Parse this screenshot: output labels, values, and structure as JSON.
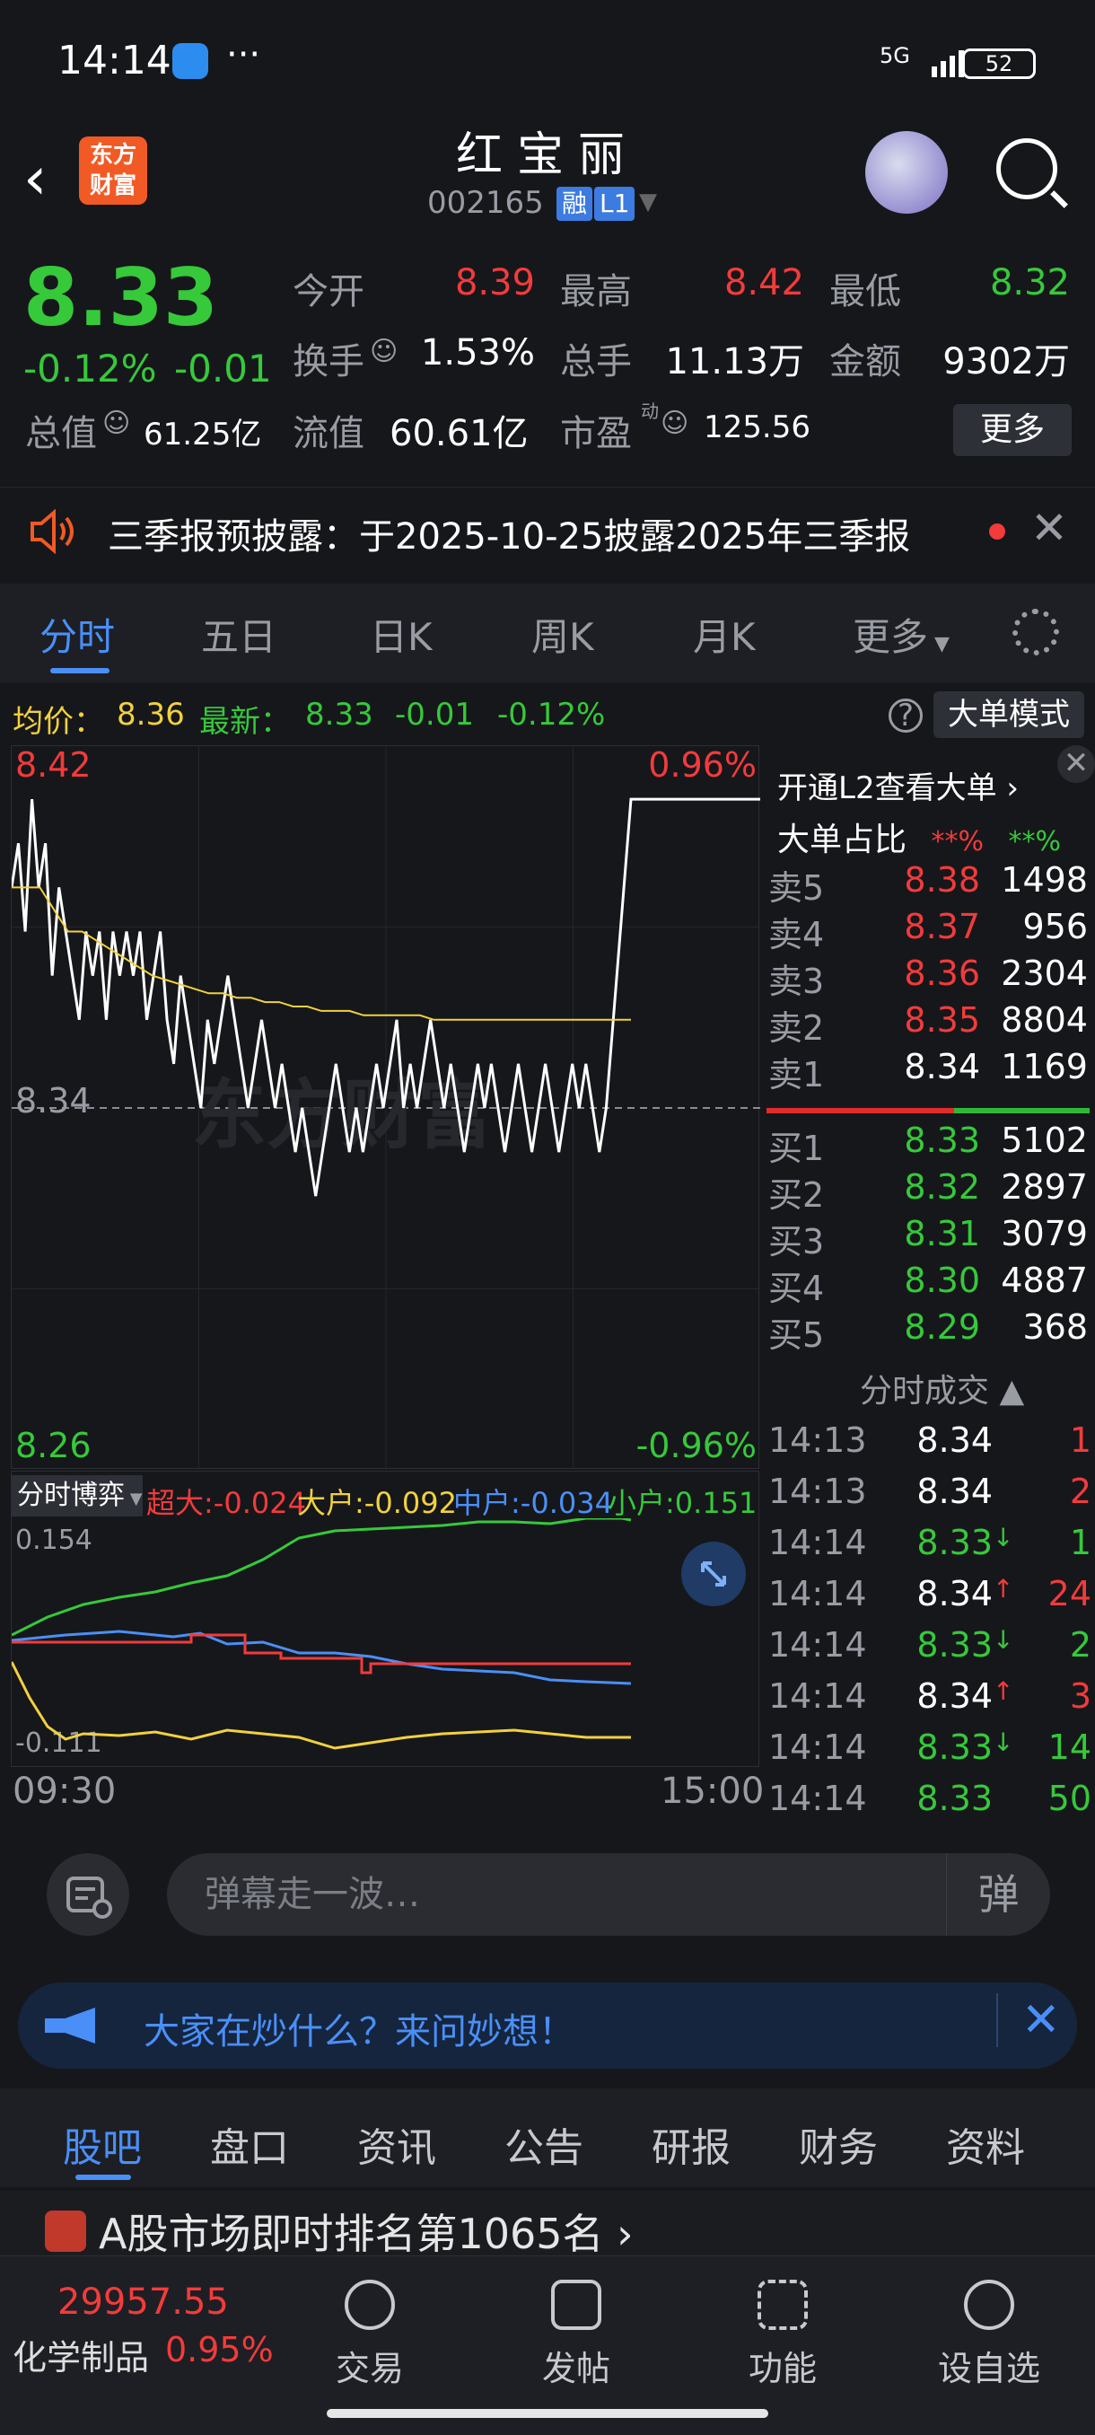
{
  "status_bar": {
    "time": "14:14",
    "more": "···",
    "network": "5G",
    "battery": "52"
  },
  "header": {
    "title": "红宝丽",
    "code": "002165",
    "tag_margin": "融",
    "tag_level": "L1",
    "logo_line1": "东方",
    "logo_line2": "财富"
  },
  "quote": {
    "price": "8.33",
    "change_pct": "-0.12%",
    "change_abs": "-0.01",
    "open_label": "今开",
    "open": "8.39",
    "high_label": "最高",
    "high": "8.42",
    "low_label": "最低",
    "low": "8.32",
    "turnover_label": "换手",
    "turnover": "1.53%",
    "volume_label": "总手",
    "volume": "11.13万",
    "amount_label": "金额",
    "amount": "9302万",
    "mktcap_label": "总值",
    "mktcap": "61.25亿",
    "float_label": "流值",
    "float_cap": "60.61亿",
    "pe_label": "市盈",
    "pe_sup": "动",
    "pe": "125.56",
    "more_label": "更多"
  },
  "notice": {
    "text": "三季报预披露：于2025-10-25披露2025年三季报"
  },
  "tabs": {
    "items": [
      "分时",
      "五日",
      "日K",
      "周K",
      "月K",
      "更多"
    ],
    "active": 0
  },
  "info_line": {
    "avg_label": "均价：",
    "avg": "8.36",
    "latest_label": "最新：",
    "latest": "8.33",
    "chg": "-0.01",
    "pct": "-0.12%",
    "big_order_mode": "大单模式",
    "help": "?"
  },
  "chart_data": {
    "type": "line",
    "y_top_label": "8.42",
    "y_mid_label": "8.34",
    "y_bottom_label": "8.26",
    "pct_top_label": "0.96%",
    "pct_bottom_label": "-0.96%",
    "watermark": "东方财富",
    "ylim": [
      8.26,
      8.42
    ],
    "prev_close": 8.34,
    "series": [
      {
        "name": "price",
        "color": "#ffffff",
        "values": [
          8.39,
          8.4,
          8.38,
          8.41,
          8.39,
          8.4,
          8.37,
          8.39,
          8.38,
          8.37,
          8.36,
          8.38,
          8.37,
          8.38,
          8.36,
          8.38,
          8.37,
          8.38,
          8.37,
          8.38,
          8.36,
          8.37,
          8.38,
          8.36,
          8.35,
          8.37,
          8.36,
          8.35,
          8.34,
          8.36,
          8.35,
          8.36,
          8.37,
          8.36,
          8.35,
          8.34,
          8.35,
          8.36,
          8.35,
          8.34,
          8.35,
          8.34,
          8.33,
          8.34,
          8.33,
          8.32,
          8.33,
          8.34,
          8.35,
          8.34,
          8.33,
          8.34,
          8.33,
          8.34,
          8.35,
          8.34,
          8.35,
          8.36,
          8.34,
          8.35,
          8.34,
          8.35,
          8.36,
          8.35,
          8.34,
          8.35,
          8.34,
          8.33,
          8.34,
          8.35,
          8.34,
          8.35,
          8.34,
          8.33,
          8.34,
          8.35,
          8.34,
          8.33,
          8.34,
          8.35,
          8.34,
          8.33,
          8.34,
          8.35,
          8.34,
          8.35,
          8.34,
          8.33,
          8.34,
          8.41,
          8.41,
          8.41,
          8.41,
          8.41
        ]
      },
      {
        "name": "avg",
        "color": "#f2d13d",
        "values": [
          8.39,
          8.39,
          8.39,
          8.385,
          8.38,
          8.38,
          8.378,
          8.376,
          8.374,
          8.372,
          8.37,
          8.369,
          8.368,
          8.367,
          8.366,
          8.366,
          8.365,
          8.365,
          8.364,
          8.364,
          8.363,
          8.363,
          8.362,
          8.362,
          8.362,
          8.361,
          8.361,
          8.361,
          8.361,
          8.361,
          8.36,
          8.36,
          8.36,
          8.36,
          8.36,
          8.36,
          8.36,
          8.36,
          8.36,
          8.36,
          8.36,
          8.36,
          8.36,
          8.36,
          8.36
        ]
      }
    ]
  },
  "flow": {
    "selector": "分时博弈",
    "super_label": "超大:",
    "super": "-0.024",
    "large_label": "大户:",
    "large": "-0.092",
    "mid_label": "中户:",
    "mid": "-0.034",
    "small_label": "小户:",
    "small": "0.151",
    "y_top": "0.154",
    "y_bottom": "-0.111",
    "time_start": "09:30",
    "time_end": "15:00"
  },
  "order_book": {
    "l2_prompt": "开通L2查看大单 ›",
    "big_ratio_label": "大单占比",
    "big_ratio_sell": "**%",
    "big_ratio_buy": "**%",
    "asks": [
      {
        "name": "卖5",
        "price": "8.38",
        "vol": "1498",
        "color": "red"
      },
      {
        "name": "卖4",
        "price": "8.37",
        "vol": "956",
        "color": "red"
      },
      {
        "name": "卖3",
        "price": "8.36",
        "vol": "2304",
        "color": "red"
      },
      {
        "name": "卖2",
        "price": "8.35",
        "vol": "8804",
        "color": "red"
      },
      {
        "name": "卖1",
        "price": "8.34",
        "vol": "1169",
        "color": "white"
      }
    ],
    "bids": [
      {
        "name": "买1",
        "price": "8.33",
        "vol": "5102",
        "color": "green"
      },
      {
        "name": "买2",
        "price": "8.32",
        "vol": "2897",
        "color": "green"
      },
      {
        "name": "买3",
        "price": "8.31",
        "vol": "3079",
        "color": "green"
      },
      {
        "name": "买4",
        "price": "8.30",
        "vol": "4887",
        "color": "green"
      },
      {
        "name": "买5",
        "price": "8.29",
        "vol": "368",
        "color": "green"
      }
    ],
    "ticks_title": "分时成交 ▲",
    "ticks": [
      {
        "time": "14:13",
        "price": "8.34",
        "pc": "white",
        "arrow": "",
        "vol": "1",
        "vc": "red"
      },
      {
        "time": "14:13",
        "price": "8.34",
        "pc": "white",
        "arrow": "",
        "vol": "2",
        "vc": "red"
      },
      {
        "time": "14:14",
        "price": "8.33",
        "pc": "green",
        "arrow": "↓",
        "vol": "1",
        "vc": "green"
      },
      {
        "time": "14:14",
        "price": "8.34",
        "pc": "white",
        "arrow": "↑",
        "vol": "24",
        "vc": "red"
      },
      {
        "time": "14:14",
        "price": "8.33",
        "pc": "green",
        "arrow": "↓",
        "vol": "2",
        "vc": "green"
      },
      {
        "time": "14:14",
        "price": "8.34",
        "pc": "white",
        "arrow": "↑",
        "vol": "3",
        "vc": "red"
      },
      {
        "time": "14:14",
        "price": "8.33",
        "pc": "green",
        "arrow": "↓",
        "vol": "14",
        "vc": "green"
      },
      {
        "time": "14:14",
        "price": "8.33",
        "pc": "green",
        "arrow": "",
        "vol": "50",
        "vc": "green"
      }
    ]
  },
  "comment": {
    "placeholder": "弹幕走一波…",
    "send": "弹"
  },
  "ask_banner": {
    "text": "大家在炒什么？来问妙想！"
  },
  "bottom_tabs": {
    "items": [
      "股吧",
      "盘口",
      "资讯",
      "公告",
      "研报",
      "财务",
      "资料"
    ],
    "active": 0
  },
  "teaser": {
    "text": "A股市场即时排名第1065名 ›"
  },
  "nav": {
    "index_value": "29957.55",
    "index_name": "化学制品",
    "index_pct": "0.95%",
    "items": [
      "交易",
      "发帖",
      "功能",
      "设自选"
    ]
  },
  "colors": {
    "up": "#f23b3b",
    "down": "#36c93a",
    "accent": "#4a8ff7",
    "avg_line": "#f2d13d"
  }
}
